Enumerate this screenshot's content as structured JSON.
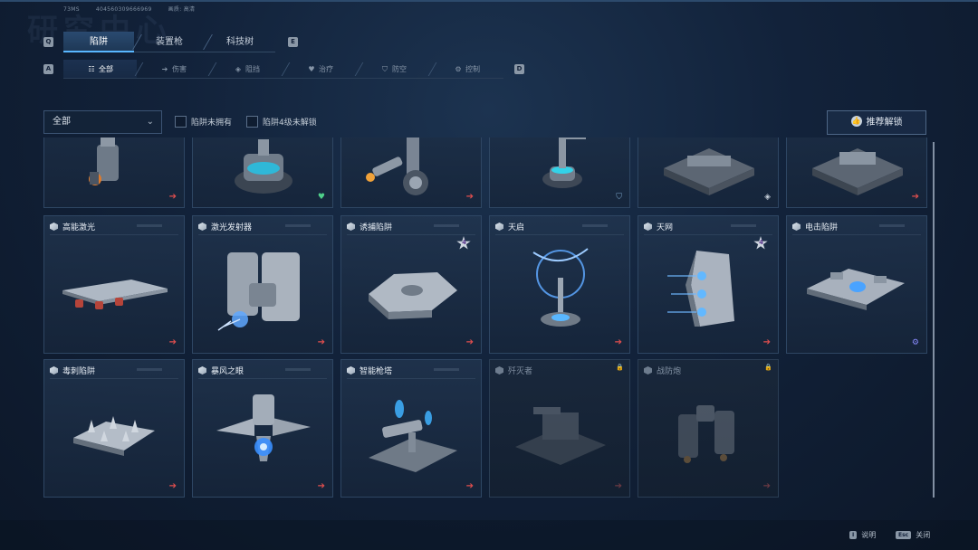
{
  "meta": {
    "ping": "73MS",
    "uid": "404560309666969",
    "quality": "画质: 高清",
    "bg_title": "研究中心"
  },
  "keys": {
    "q": "Q",
    "e": "E",
    "a": "A",
    "d": "D"
  },
  "main_tabs": [
    {
      "label": "陷阱",
      "active": true
    },
    {
      "label": "装置枪",
      "active": false
    },
    {
      "label": "科技树",
      "active": false
    }
  ],
  "sub_tabs": [
    {
      "label": "全部",
      "icon": "grid-icon",
      "glyph": "☷",
      "active": true
    },
    {
      "label": "伤害",
      "icon": "damage-arrow-icon",
      "glyph": "➔",
      "active": false
    },
    {
      "label": "阻挡",
      "icon": "block-shield-icon",
      "glyph": "◈",
      "active": false
    },
    {
      "label": "治疗",
      "icon": "heal-heart-icon",
      "glyph": "♥",
      "active": false
    },
    {
      "label": "防空",
      "icon": "anti-air-shield-icon",
      "glyph": "⛉",
      "active": false
    },
    {
      "label": "控制",
      "icon": "control-gear-icon",
      "glyph": "⚙",
      "active": false
    }
  ],
  "filters": {
    "dropdown_value": "全部",
    "check_not_owned": "陷阱未拥有",
    "check_lv4_locked": "陷阱4级未解锁",
    "recommend_button": "推荐解锁"
  },
  "cards_top": [
    {
      "name": "",
      "badge": "arrow"
    },
    {
      "name": "",
      "badge": "heal"
    },
    {
      "name": "",
      "badge": "arrow"
    },
    {
      "name": "",
      "badge": "shield"
    },
    {
      "name": "",
      "badge": "block"
    },
    {
      "name": "",
      "badge": "arrow"
    }
  ],
  "cards": [
    {
      "name": "高能激光",
      "badge": "arrow",
      "locked": false,
      "star": ""
    },
    {
      "name": "激光发射器",
      "badge": "arrow",
      "locked": false,
      "star": ""
    },
    {
      "name": "诱捕陷阱",
      "badge": "arrow",
      "locked": false,
      "star": "4"
    },
    {
      "name": "天启",
      "badge": "arrow",
      "locked": false,
      "star": ""
    },
    {
      "name": "天网",
      "badge": "arrow",
      "locked": false,
      "star": "4"
    },
    {
      "name": "电击陷阱",
      "badge": "control",
      "locked": false,
      "star": ""
    },
    {
      "name": "毒刺陷阱",
      "badge": "arrow",
      "locked": false,
      "star": ""
    },
    {
      "name": "暴风之眼",
      "badge": "arrow",
      "locked": false,
      "star": ""
    },
    {
      "name": "智能枪塔",
      "badge": "arrow",
      "locked": false,
      "star": ""
    },
    {
      "name": "歼灭者",
      "badge": "arrow",
      "locked": true,
      "star": ""
    },
    {
      "name": "战防炮",
      "badge": "arrow",
      "locked": true,
      "star": ""
    }
  ],
  "footer": {
    "help_key": "I",
    "help_label": "说明",
    "close_key": "Esc",
    "close_label": "关闭"
  },
  "colors": {
    "accent": "#59b7ff",
    "arrow": "#e04e4e",
    "heal": "#4fd08a",
    "control": "#8a8cff"
  }
}
